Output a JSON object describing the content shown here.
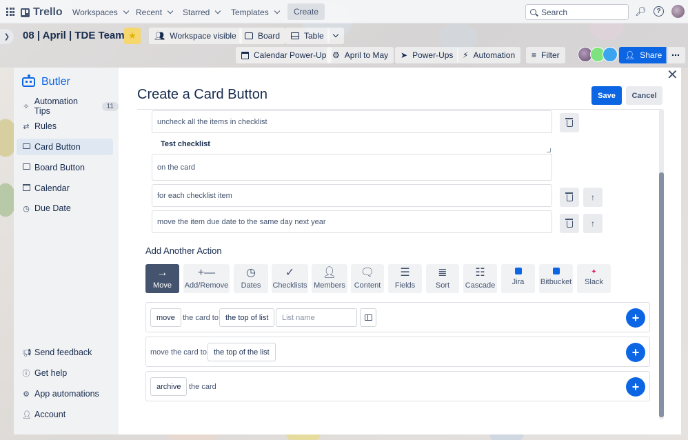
{
  "topbar": {
    "brand": "Trello",
    "nav": [
      "Workspaces",
      "Recent",
      "Starred",
      "Templates"
    ],
    "create_label": "Create",
    "search_placeholder": "Search"
  },
  "boardbar": {
    "board_name": "08 | April | TDE Team",
    "visibility_label": "Workspace visible",
    "board_view": "Board",
    "table_view": "Table",
    "calendar_powerup": "Calendar Power-Up",
    "april_to_may": "April to May",
    "powerups": "Power-Ups",
    "automation": "Automation",
    "filter": "Filter",
    "share": "Share"
  },
  "sidebar": {
    "title": "Butler",
    "tips_label": "Automation Tips",
    "tips_count": "11",
    "items": [
      "Rules",
      "Card Button",
      "Board Button",
      "Calendar",
      "Due Date"
    ],
    "active": "Card Button",
    "footer": [
      "Send feedback",
      "Get help",
      "App automations",
      "Account"
    ]
  },
  "main": {
    "title": "Create a Card Button",
    "save": "Save",
    "cancel": "Cancel",
    "action1_text": "uncheck all the items in checklist",
    "checklist_value": "Test checklist",
    "action1_suffix": "on the card",
    "action2_text": "for each checklist item",
    "action3_text": "move the item due date to the same day next year",
    "add_another_action": "Add Another Action",
    "action_types": [
      "Move",
      "Add/Remove",
      "Dates",
      "Checklists",
      "Members",
      "Content",
      "Fields",
      "Sort",
      "Cascade",
      "Jira",
      "Bitbucket",
      "Slack"
    ],
    "active_action_type": "Move",
    "option1": {
      "chip": "move",
      "text": "the card to",
      "position": "the top of list",
      "list_placeholder": "List name"
    },
    "option2": {
      "text": "move the card to",
      "position": "the top of the list"
    },
    "option3": {
      "chip": "archive",
      "text": "the card"
    }
  },
  "colors": {
    "accent": "#0c66e4",
    "active_bg": "#44546f",
    "sidebar_active": "#dfe8f2"
  }
}
